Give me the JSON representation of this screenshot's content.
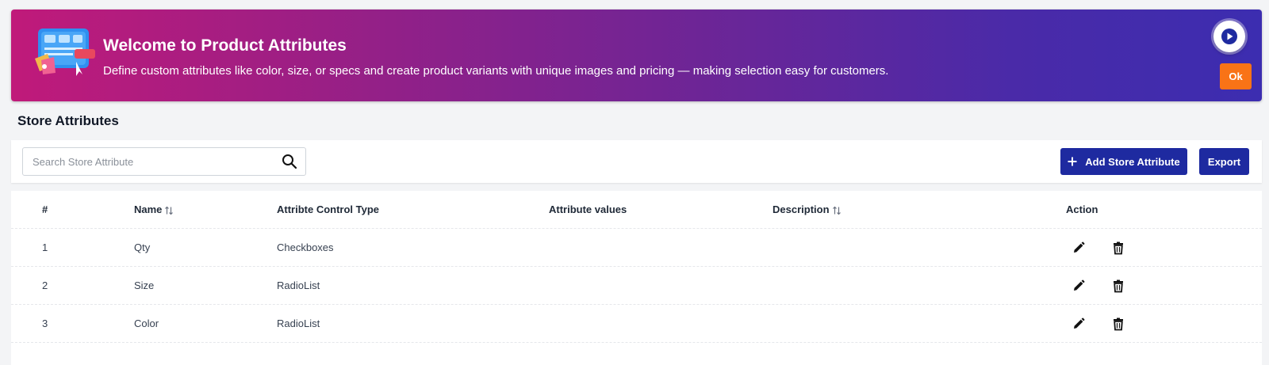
{
  "banner": {
    "title": "Welcome to Product Attributes",
    "description": "Define custom attributes like color, size, or specs and create product variants with unique images and pricing — making selection easy for customers.",
    "ok_label": "Ok",
    "gradient_start": "#c01a7a",
    "gradient_end": "#3c2db0",
    "icon": "play-icon"
  },
  "page": {
    "section_title": "Store Attributes"
  },
  "toolbar": {
    "search_placeholder": "Search Store Attribute",
    "search_value": "",
    "add_label": "Add Store Attribute",
    "export_label": "Export",
    "button_color": "#1e2aa0"
  },
  "table": {
    "columns": [
      "#",
      "Name",
      "Attribte Control Type",
      "Attribute values",
      "Description",
      "Action"
    ],
    "rows": [
      {
        "num": "1",
        "name": "Qty",
        "type": "Checkboxes",
        "values": "",
        "description": ""
      },
      {
        "num": "2",
        "name": "Size",
        "type": "RadioList",
        "values": "",
        "description": ""
      },
      {
        "num": "3",
        "name": "Color",
        "type": "RadioList",
        "values": "",
        "description": ""
      }
    ]
  }
}
